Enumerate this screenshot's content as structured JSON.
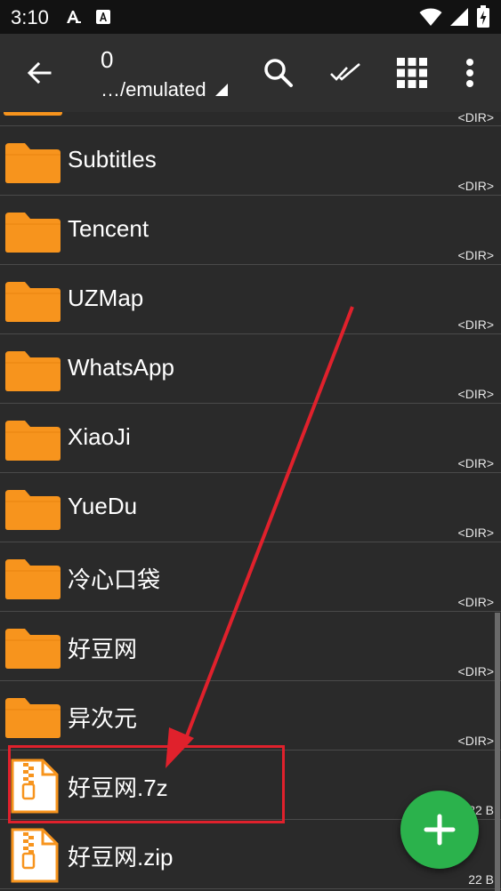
{
  "status_bar": {
    "time": "3:10",
    "left_icons": [
      "font-app-icon",
      "font-app-icon-2"
    ],
    "right_icons": [
      "wifi-icon",
      "signal-icon",
      "battery-icon"
    ]
  },
  "app_bar": {
    "count": "0",
    "path": "…/emulated",
    "icons": [
      "back-arrow-icon",
      "search-icon",
      "double-check-icon",
      "grid-view-icon",
      "more-vert-icon"
    ]
  },
  "files": {
    "partial_top": {
      "meta": "<DIR>"
    },
    "items": [
      {
        "name": "Subtitles",
        "meta": "<DIR>",
        "type": "folder"
      },
      {
        "name": "Tencent",
        "meta": "<DIR>",
        "type": "folder"
      },
      {
        "name": "UZMap",
        "meta": "<DIR>",
        "type": "folder"
      },
      {
        "name": "WhatsApp",
        "meta": "<DIR>",
        "type": "folder"
      },
      {
        "name": "XiaoJi",
        "meta": "<DIR>",
        "type": "folder"
      },
      {
        "name": "YueDu",
        "meta": "<DIR>",
        "type": "folder"
      },
      {
        "name": "冷心口袋",
        "meta": "<DIR>",
        "type": "folder"
      },
      {
        "name": "好豆网",
        "meta": "<DIR>",
        "type": "folder"
      },
      {
        "name": "异次元",
        "meta": "<DIR>",
        "type": "folder"
      },
      {
        "name": "好豆网.7z",
        "meta": "22 B",
        "type": "archive"
      },
      {
        "name": "好豆网.zip",
        "meta": "22 B",
        "type": "archive"
      }
    ]
  },
  "fab": {
    "icon": "plus-icon"
  },
  "colors": {
    "folder": "#f7941d",
    "annotation": "#e0212c",
    "fab": "#2bb24c",
    "app_bar": "#2f2f2f",
    "background": "#2a2a2a"
  }
}
